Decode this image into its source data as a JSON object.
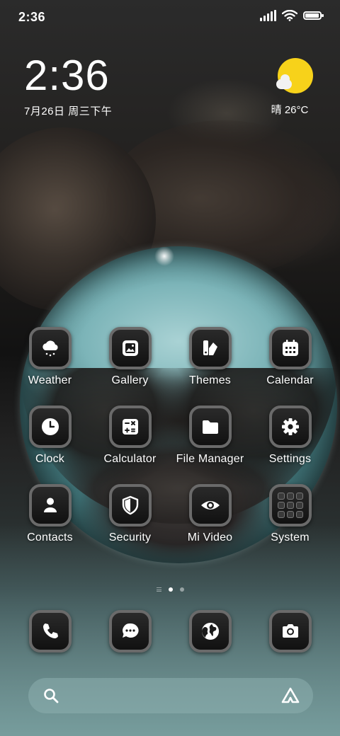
{
  "status_bar": {
    "time": "2:36",
    "battery_level": 0.95
  },
  "clock_widget": {
    "time": "2:36",
    "date": "7月26日 周三下午"
  },
  "weather_widget": {
    "text": "晴 26°C",
    "icon": "sun-behind-cloud-icon"
  },
  "apps": [
    {
      "label": "Weather",
      "icon": "cloud-snow-icon"
    },
    {
      "label": "Gallery",
      "icon": "image-icon"
    },
    {
      "label": "Themes",
      "icon": "brush-icon"
    },
    {
      "label": "Calendar",
      "icon": "calendar-icon"
    },
    {
      "label": "Clock",
      "icon": "clock-icon"
    },
    {
      "label": "Calculator",
      "icon": "calculator-icon"
    },
    {
      "label": "File Manager",
      "icon": "folder-icon"
    },
    {
      "label": "Settings",
      "icon": "gear-icon"
    },
    {
      "label": "Contacts",
      "icon": "person-icon"
    },
    {
      "label": "Security",
      "icon": "shield-icon"
    },
    {
      "label": "Mi Video",
      "icon": "eye-icon"
    },
    {
      "label": "System",
      "icon": "folder-grid-icon"
    }
  ],
  "page_indicator": {
    "pages": 2,
    "current": 1
  },
  "dock": [
    {
      "icon": "phone-icon"
    },
    {
      "icon": "message-icon"
    },
    {
      "icon": "globe-icon"
    },
    {
      "icon": "camera-icon"
    }
  ],
  "search": {
    "placeholder": "",
    "left_icon": "search-icon",
    "right_icon": "assistant-icon"
  },
  "colors": {
    "sun": "#f7d21a",
    "icon_border": "#6a6a6a",
    "icon_bg": "#111111"
  }
}
